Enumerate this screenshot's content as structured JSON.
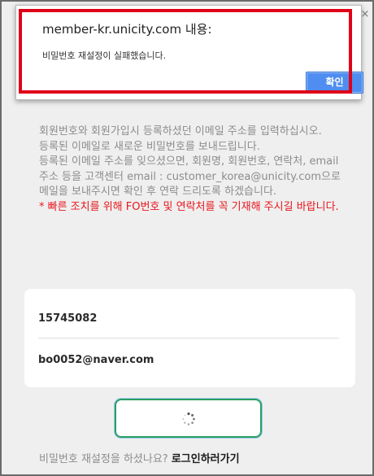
{
  "alert": {
    "title": "member-kr.unicity.com 내용:",
    "message": "비밀번호 재설정이 실패했습니다.",
    "ok_label": "확인",
    "close_glyph": "×"
  },
  "instructions": {
    "lines": [
      "회원번호와 회원가입시 등록하셨던 이메일 주소를 입력하십시오.",
      "등록된 이메일로 새로운 비밀번호를 보내드립니다.",
      "등록된 이메일 주소를 잊으셨으면, 회원명, 회원번호, 연락처, email 주소 등을 고객센터 email : customer_korea@unicity.com으로 메일을 보내주시면 확인 후 연락 드리도록 하겠습니다."
    ],
    "warning": "* 빠른 조치를 위해 FO번호 및 연락처를 꼭 기재해 주시길 바랍니다."
  },
  "form": {
    "member_id": "15745082",
    "email": "bo0052@naver.com"
  },
  "submit": {
    "state": "loading",
    "icon": "spinner-icon"
  },
  "footer": {
    "question": "비밀번호 재설정을 하셨나요?",
    "login_link": "로그인하러가기"
  },
  "colors": {
    "dialog_highlight": "#e00018",
    "ok_button": "#4f8ef0",
    "warning_text": "#e8161c",
    "submit_border": "#2aa060",
    "page_bg": "#efefef"
  }
}
